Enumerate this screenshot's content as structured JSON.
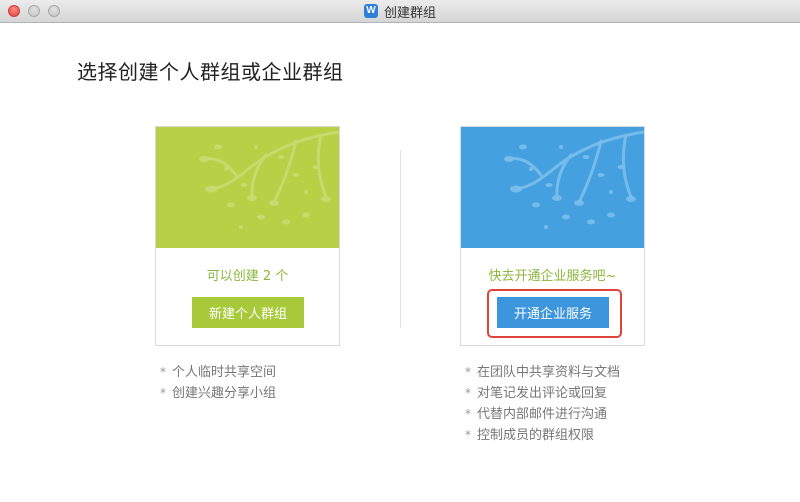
{
  "window": {
    "title": "创建群组",
    "app_icon_glyph": "W",
    "traffic_lights": [
      "close",
      "minimize",
      "zoom"
    ]
  },
  "page": {
    "heading": "选择创建个人群组或企业群组"
  },
  "personal_card": {
    "banner_color": "#b8d045",
    "caption": "可以创建 2 个",
    "button_label": "新建个人群组",
    "features": [
      "个人临时共享空间",
      "创建兴趣分享小组"
    ]
  },
  "enterprise_card": {
    "banner_color": "#45a0e0",
    "caption": "快去开通企业服务吧~",
    "button_label": "开通企业服务",
    "button_highlighted": true,
    "highlight_color": "#e0433a",
    "features": [
      "在团队中共享资料与文档",
      "对笔记发出评论或回复",
      "代替内部邮件进行沟通",
      "控制成员的群组权限"
    ]
  },
  "colors": {
    "accent_green": "#a7c93a",
    "accent_blue": "#3d95dc",
    "caption_green": "#8cb63c"
  },
  "bullet_glyph": "*"
}
